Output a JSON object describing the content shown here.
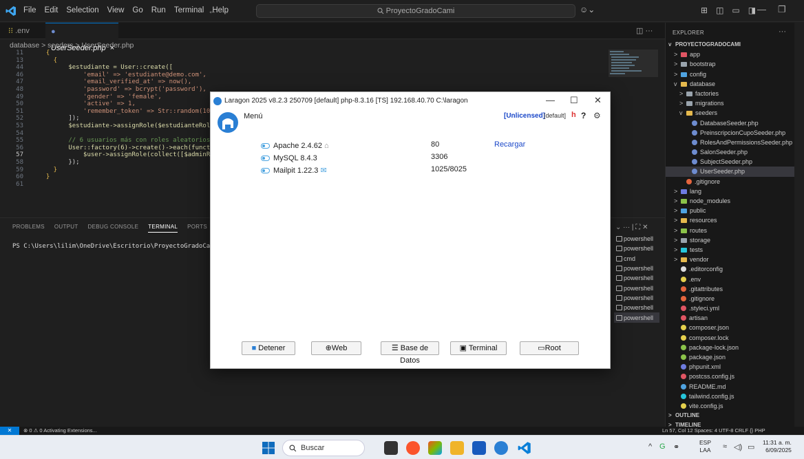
{
  "titlebar": {
    "menu": [
      "File",
      "Edit",
      "Selection",
      "View",
      "Go",
      "Run",
      "Terminal",
      "Help"
    ],
    "search": "ProyectoGradoCami"
  },
  "tabs": [
    {
      "label": ".env",
      "close": "×"
    },
    {
      "label": "UserSeeder.php",
      "close": "×"
    }
  ],
  "breadcrumb": "database > seeders > UserSeeder.php",
  "code": {
    "line_numbers": [
      "11",
      "13",
      "44",
      "46",
      "47",
      "48",
      "49",
      "50",
      "51",
      "52",
      "53",
      "54",
      "55",
      "56",
      "57",
      "58",
      "59",
      "60",
      "61"
    ],
    "lines": [
      [
        "  {"
      ],
      [
        "    {"
      ],
      [
        "        $estudiante = User::create(["
      ],
      [
        "            'email' => 'estudiante@demo.com',"
      ],
      [
        "            'email_verified_at' => now(),"
      ],
      [
        "            'password' => bcrypt('password'),"
      ],
      [
        "            'gender' => 'female',"
      ],
      [
        "            'active' => 1,"
      ],
      [
        "            'remember_token' => Str::random(10),"
      ],
      [
        "        ]);"
      ],
      [
        "        $estudiante->assignRole($estudianteRole);"
      ],
      [
        ""
      ],
      [
        "        // 6 usuarios más con roles aleatorios"
      ],
      [
        "        User::factory(6)->create()->each(function ($"
      ],
      [
        "            $user->assignRole(collect([$adminRole, $"
      ],
      [
        "        });"
      ],
      [
        "    }"
      ],
      [
        "  }"
      ],
      [
        ""
      ]
    ]
  },
  "panel": {
    "tabs": [
      "PROBLEMS",
      "OUTPUT",
      "DEBUG CONSOLE",
      "TERMINAL",
      "PORTS"
    ],
    "prompt": "PS C:\\Users\\lilim\\OneDrive\\Escritorio\\ProyectoGradoCami>",
    "terminals": [
      "powershell",
      "powershell",
      "cmd",
      "powershell",
      "powershell",
      "powershell",
      "powershell",
      "powershell",
      "powershell"
    ]
  },
  "explorer": {
    "title": "EXPLORER",
    "root": "PROYECTOGRADOCAMI",
    "items": [
      {
        "label": "app",
        "indent": 1,
        "ch": ">",
        "color": "#e05563"
      },
      {
        "label": "bootstrap",
        "indent": 1,
        "ch": ">",
        "color": "#9aa4ad"
      },
      {
        "label": "config",
        "indent": 1,
        "ch": ">",
        "color": "#4fa3e0"
      },
      {
        "label": "database",
        "indent": 1,
        "ch": "v",
        "color": "#e5b94d"
      },
      {
        "label": "factories",
        "indent": 2,
        "ch": ">",
        "color": "#9aa4ad"
      },
      {
        "label": "migrations",
        "indent": 2,
        "ch": ">",
        "color": "#9aa4ad"
      },
      {
        "label": "seeders",
        "indent": 2,
        "ch": "v",
        "color": "#e5b94d"
      },
      {
        "label": "DatabaseSeeder.php",
        "indent": 3,
        "ch": "",
        "color": "#6e8ccf",
        "dot": true
      },
      {
        "label": "PreinscripcionCupoSeeder.php",
        "indent": 3,
        "ch": "",
        "color": "#6e8ccf",
        "dot": true
      },
      {
        "label": "RolesAndPermissionsSeeder.php",
        "indent": 3,
        "ch": "",
        "color": "#6e8ccf",
        "dot": true
      },
      {
        "label": "SalonSeeder.php",
        "indent": 3,
        "ch": "",
        "color": "#6e8ccf",
        "dot": true
      },
      {
        "label": "SubjectSeeder.php",
        "indent": 3,
        "ch": "",
        "color": "#6e8ccf",
        "dot": true
      },
      {
        "label": "UserSeeder.php",
        "indent": 3,
        "ch": "",
        "color": "#6e8ccf",
        "dot": true,
        "selected": true
      },
      {
        "label": ".gitignore",
        "indent": 2,
        "ch": "",
        "color": "#e5653e",
        "dot": true
      },
      {
        "label": "lang",
        "indent": 1,
        "ch": ">",
        "color": "#6e7ce0"
      },
      {
        "label": "node_modules",
        "indent": 1,
        "ch": ">",
        "color": "#8bc34a"
      },
      {
        "label": "public",
        "indent": 1,
        "ch": ">",
        "color": "#4fa3e0"
      },
      {
        "label": "resources",
        "indent": 1,
        "ch": ">",
        "color": "#e5b94d"
      },
      {
        "label": "routes",
        "indent": 1,
        "ch": ">",
        "color": "#8bc34a"
      },
      {
        "label": "storage",
        "indent": 1,
        "ch": ">",
        "color": "#9aa4ad"
      },
      {
        "label": "tests",
        "indent": 1,
        "ch": ">",
        "color": "#26c6da"
      },
      {
        "label": "vendor",
        "indent": 1,
        "ch": ">",
        "color": "#e5b94d"
      },
      {
        "label": ".editorconfig",
        "indent": 1,
        "ch": "",
        "color": "#ddd",
        "dot": true
      },
      {
        "label": ".env",
        "indent": 1,
        "ch": "",
        "color": "#e5d04d",
        "dot": true
      },
      {
        "label": ".gitattributes",
        "indent": 1,
        "ch": "",
        "color": "#e5653e",
        "dot": true
      },
      {
        "label": ".gitignore",
        "indent": 1,
        "ch": "",
        "color": "#e5653e",
        "dot": true
      },
      {
        "label": ".styleci.yml",
        "indent": 1,
        "ch": "",
        "color": "#e05563",
        "dot": true
      },
      {
        "label": "artisan",
        "indent": 1,
        "ch": "",
        "color": "#e05563",
        "dot": true
      },
      {
        "label": "composer.json",
        "indent": 1,
        "ch": "",
        "color": "#e5d04d",
        "dot": true
      },
      {
        "label": "composer.lock",
        "indent": 1,
        "ch": "",
        "color": "#e5d04d",
        "dot": true
      },
      {
        "label": "package-lock.json",
        "indent": 1,
        "ch": "",
        "color": "#8bc34a",
        "dot": true
      },
      {
        "label": "package.json",
        "indent": 1,
        "ch": "",
        "color": "#8bc34a",
        "dot": true
      },
      {
        "label": "phpunit.xml",
        "indent": 1,
        "ch": "",
        "color": "#6e7ce0",
        "dot": true
      },
      {
        "label": "postcss.config.js",
        "indent": 1,
        "ch": "",
        "color": "#e05563",
        "dot": true
      },
      {
        "label": "README.md",
        "indent": 1,
        "ch": "",
        "color": "#4fa3e0",
        "dot": true
      },
      {
        "label": "tailwind.config.js",
        "indent": 1,
        "ch": "",
        "color": "#26c6da",
        "dot": true
      },
      {
        "label": "vite.config.js",
        "indent": 1,
        "ch": "",
        "color": "#e5d04d",
        "dot": true
      },
      {
        "label": "OUTLINE",
        "indent": 0,
        "ch": ">",
        "section": true
      },
      {
        "label": "TIMELINE",
        "indent": 0,
        "ch": ">",
        "section": true
      }
    ]
  },
  "status": {
    "left": "⊗ 0 ⚠ 0   Activating Extensions...",
    "right": "Ln 57, Col 12   Spaces: 4   UTF-8   CRLF   {} PHP"
  },
  "taskbar": {
    "search": "Buscar",
    "lang1": "ESP",
    "lang2": "LAA",
    "time": "11:31 a. m.",
    "date": "6/09/2025"
  },
  "laragon": {
    "title": "Laragon 2025 v8.2.3 250709 [default] php-8.3.16 [TS]  192.168.40.70  C:\\laragon",
    "menu": "Menú",
    "unlicensed": "[Unlicensed]",
    "default": "[default]",
    "h": "h",
    "q": "?",
    "services": [
      {
        "name": "Apache 2.4.62",
        "port": "80"
      },
      {
        "name": "MySQL 8.4.3",
        "port": "3306"
      },
      {
        "name": "Mailpit 1.22.3",
        "port": "1025/8025"
      }
    ],
    "reload": "Recargar",
    "buttons": [
      "Detener",
      "Web",
      "Base de Datos",
      "Terminal",
      "Root"
    ]
  }
}
